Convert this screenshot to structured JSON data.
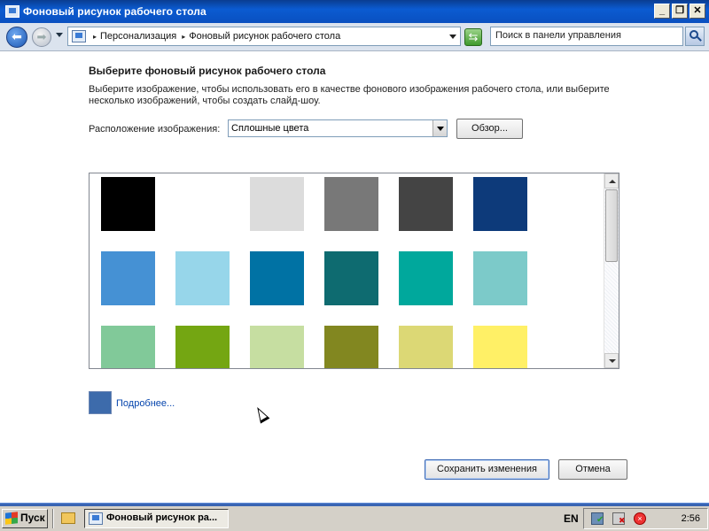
{
  "window": {
    "title": "Фоновый рисунок рабочего стола",
    "minimize": "_",
    "restore": "❐",
    "close": "✕"
  },
  "address": {
    "breadcrumbs": [
      "Персонализация",
      "Фоновый рисунок рабочего стола"
    ],
    "search_placeholder": "Поиск в панели управления"
  },
  "main": {
    "title": "Выберите фоновый рисунок рабочего стола",
    "description": "Выберите изображение, чтобы использовать его в качестве фонового изображения рабочего стола, или выберите несколько изображений, чтобы создать слайд-шоу.",
    "location_label": "Расположение изображения:",
    "location_value": "Сплошные цвета",
    "browse_label": "Обзор...",
    "swatches": [
      "#000000",
      "#ffffff",
      "#dcdcdc",
      "#787878",
      "#444444",
      "#0d3a7a",
      "#4591d4",
      "#97d6ea",
      "#0072a4",
      "#0e6b70",
      "#00a89c",
      "#7ccac9",
      "#81c999",
      "#74a612",
      "#c6dea1",
      "#828720",
      "#dcd875",
      "#fff066"
    ],
    "more_color": "#3d6bab",
    "more_label": "Подробнее...",
    "save_label": "Сохранить изменения",
    "cancel_label": "Отмена"
  },
  "taskbar": {
    "start_label": "Пуск",
    "task_label": "Фоновый рисунок ра...",
    "language": "EN",
    "clock": "2:56"
  }
}
